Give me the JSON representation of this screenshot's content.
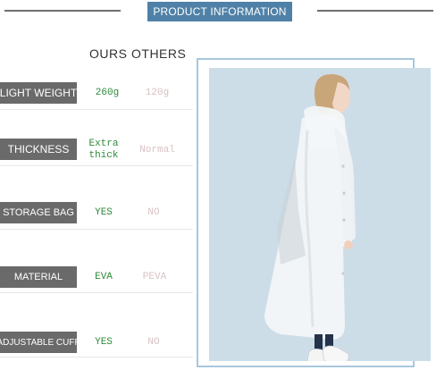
{
  "header": {
    "title": "PRODUCT INFORMATION"
  },
  "columns": {
    "ours": "OURS",
    "others": "OTHERS"
  },
  "rows": [
    {
      "label": "LIGHT WEIGHT",
      "ours": "260g",
      "others": "120g"
    },
    {
      "label": "THICKNESS",
      "ours": "Extra thick",
      "others": "Normal"
    },
    {
      "label": "STORAGE BAG",
      "ours": "YES",
      "others": "NO"
    },
    {
      "label": "MATERIAL",
      "ours": "EVA",
      "others": "PEVA"
    },
    {
      "label": "ADJUSTABLE CUFF",
      "ours": "YES",
      "others": "NO"
    }
  ],
  "colors": {
    "banner": "#4f81a8",
    "label_bg": "#6a6a6a",
    "ours_text": "#2e8b3a",
    "others_text": "#d9c2c2",
    "photo_bg": "#ccdde8"
  }
}
